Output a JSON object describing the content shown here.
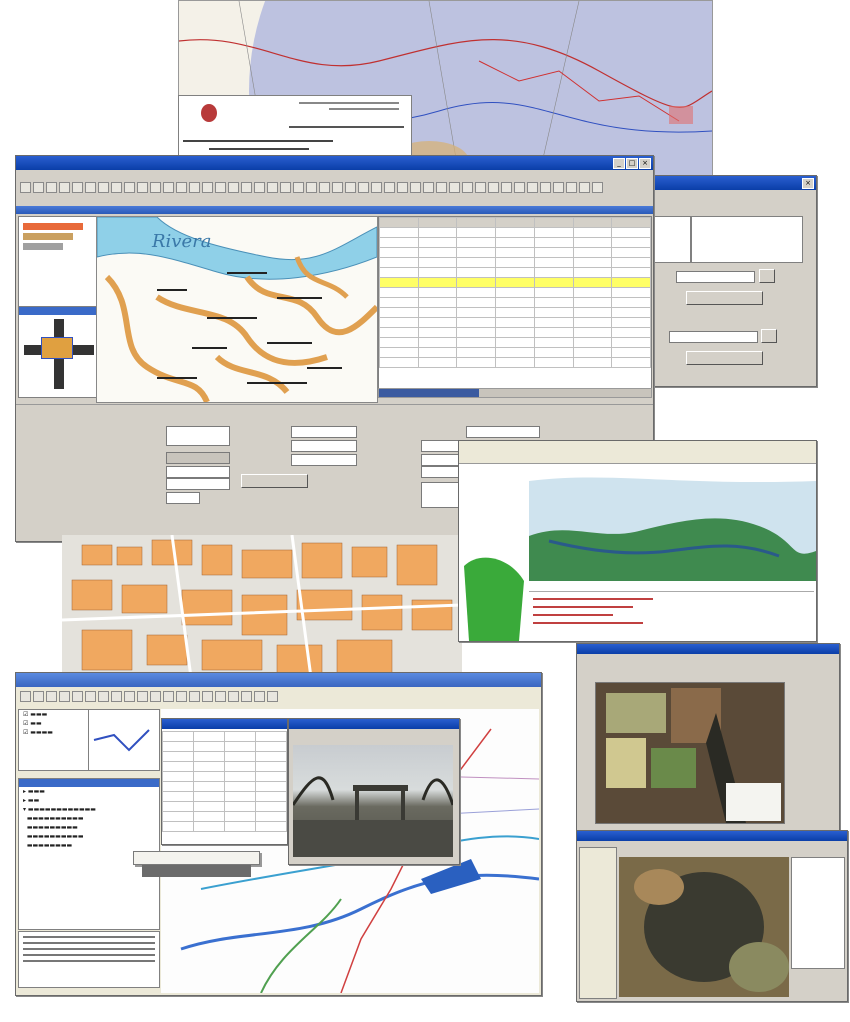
{
  "collage": {
    "report_doc": {
      "line1": "",
      "line2": "",
      "line3": ""
    },
    "main_window": {
      "title": "",
      "riverlabel": "Rivera",
      "grid_headers": [
        "",
        "",
        "",
        "",
        "",
        "",
        ""
      ],
      "grid_rows": [
        [
          "",
          "",
          "",
          "",
          "",
          "",
          ""
        ],
        [
          "",
          "",
          "",
          "",
          "",
          "",
          ""
        ],
        [
          "",
          "",
          "",
          "",
          "",
          "",
          ""
        ],
        [
          "",
          "",
          "",
          "",
          "",
          "",
          ""
        ],
        [
          "",
          "",
          "",
          "",
          "",
          "",
          ""
        ],
        [
          "",
          "",
          "",
          "",
          "",
          "",
          ""
        ],
        [
          "",
          "",
          "",
          "",
          "",
          "",
          ""
        ],
        [
          "",
          "",
          "",
          "",
          "",
          "",
          ""
        ],
        [
          "",
          "",
          "",
          "",
          "",
          "",
          ""
        ],
        [
          "",
          "",
          "",
          "",
          "",
          "",
          ""
        ],
        [
          "",
          "",
          "",
          "",
          "",
          "",
          ""
        ],
        [
          "",
          "",
          "",
          "",
          "",
          "",
          ""
        ],
        [
          "",
          "",
          "",
          "",
          "",
          "",
          ""
        ],
        [
          "",
          "",
          "",
          "",
          "",
          "",
          ""
        ]
      ],
      "highlight_row_index": 5,
      "ok_label": "",
      "cancel_label": ""
    },
    "right_dialog": {
      "title": "",
      "combo1": "",
      "combo2": "",
      "btn1": "",
      "btn2": ""
    },
    "lower_left_window": {
      "title": "",
      "context_menu_items": [
        "",
        "",
        "",
        "",
        "",
        "",
        "",
        "",
        "",
        "",
        ""
      ],
      "selected_index": 1
    },
    "photo_window": {
      "title": ""
    },
    "satellite_win1": {
      "title": ""
    },
    "satellite_win2": {
      "title": ""
    }
  },
  "colors": {
    "titlebar": "#0a3ea8",
    "window_face": "#d4d0c8",
    "river": "#8fd0e8",
    "contour": "#e0a050",
    "buffer_circle": "#7a8ad8",
    "highlight": "#ffff66",
    "city_blocks": "#f0a860",
    "green_area": "#3a9a3a"
  }
}
